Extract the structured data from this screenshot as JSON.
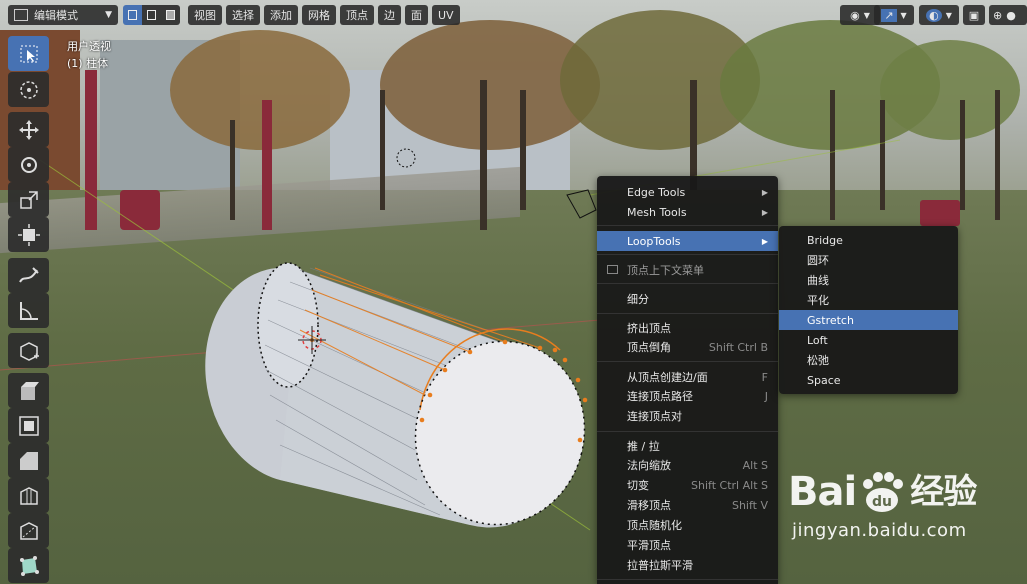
{
  "header": {
    "mode_label": "编辑模式",
    "menus": [
      "视图",
      "选择",
      "添加",
      "网格",
      "顶点",
      "边",
      "面",
      "UV"
    ]
  },
  "viewport": {
    "view_name": "用户透视",
    "object_name": "(1) 柱体"
  },
  "toolbar": {
    "icons": [
      "select-box-icon",
      "cursor-icon",
      "move-icon",
      "rotate-icon",
      "scale-icon",
      "transform-icon",
      "annotate-icon",
      "measure-icon",
      "add-cube-icon",
      "extrude-region-icon",
      "inset-faces-icon",
      "bevel-icon",
      "loop-cut-icon",
      "knife-icon",
      "poly-build-icon"
    ]
  },
  "context_menu": {
    "items": [
      {
        "label": "Edge Tools",
        "submenu": true
      },
      {
        "label": "Mesh Tools",
        "submenu": true
      },
      {
        "label": "LoopTools",
        "submenu": true,
        "highlighted": true
      },
      {
        "label": "顶点上下文菜单",
        "title": true
      },
      {
        "label": "细分"
      },
      {
        "label": "挤出顶点"
      },
      {
        "label": "顶点倒角",
        "shortcut": "Shift Ctrl B"
      },
      {
        "label": "从顶点创建边/面",
        "shortcut": "F"
      },
      {
        "label": "连接顶点路径",
        "shortcut": "J"
      },
      {
        "label": "连接顶点对"
      },
      {
        "label": "推 / 拉"
      },
      {
        "label": "法向缩放",
        "shortcut": "Alt S"
      },
      {
        "label": "切变",
        "shortcut": "Shift Ctrl Alt S"
      },
      {
        "label": "滑移顶点",
        "shortcut": "Shift V"
      },
      {
        "label": "顶点随机化"
      },
      {
        "label": "平滑顶点"
      },
      {
        "label": "拉普拉斯平滑"
      }
    ]
  },
  "submenu": {
    "items": [
      "Bridge",
      "圆环",
      "曲线",
      "平化",
      "Gstretch",
      "Loft",
      "松弛",
      "Space"
    ],
    "highlighted_index": 4
  },
  "watermark": {
    "logo_left": "Bai",
    "logo_right": "经验",
    "url": "jingyan.baidu.com"
  },
  "colors": {
    "accent": "#4772b3",
    "selected_edge": "#e87d1e",
    "menu_bg": "#181818"
  }
}
